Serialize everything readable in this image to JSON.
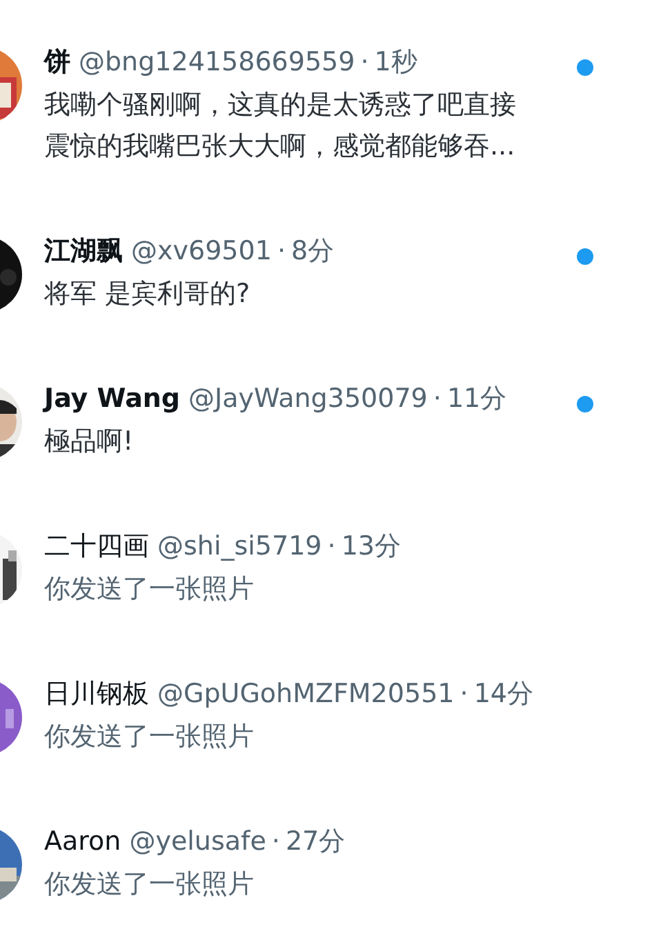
{
  "conversations": [
    {
      "name": "饼",
      "handle": "@bng124158669559",
      "separator": "·",
      "time": "1秒",
      "message": "我嘞个骚刚啊，这真的是太诱惑了吧直接震惊的我嘴巴张大大啊，感觉都能够吞...",
      "unread": true
    },
    {
      "name": "江湖飘",
      "handle": "@xv69501",
      "separator": "·",
      "time": "8分",
      "message": "将军 是宾利哥的?",
      "unread": true
    },
    {
      "name": "Jay Wang",
      "handle": "@JayWang350079",
      "separator": "·",
      "time": "11分",
      "message": "極品啊!",
      "unread": true
    },
    {
      "name": "二十四画",
      "handle": "@shi_si5719",
      "separator": "·",
      "time": "13分",
      "message": "你发送了一张照片",
      "unread": false
    },
    {
      "name": "日川钢板",
      "handle": "@GpUGohMZFM20551",
      "separator": "·",
      "time": "14分",
      "message": "你发送了一张照片",
      "unread": false
    },
    {
      "name": "Aaron",
      "handle": "@yelusafe",
      "separator": "·",
      "time": "27分",
      "message": "你发送了一张照片",
      "unread": false
    }
  ]
}
